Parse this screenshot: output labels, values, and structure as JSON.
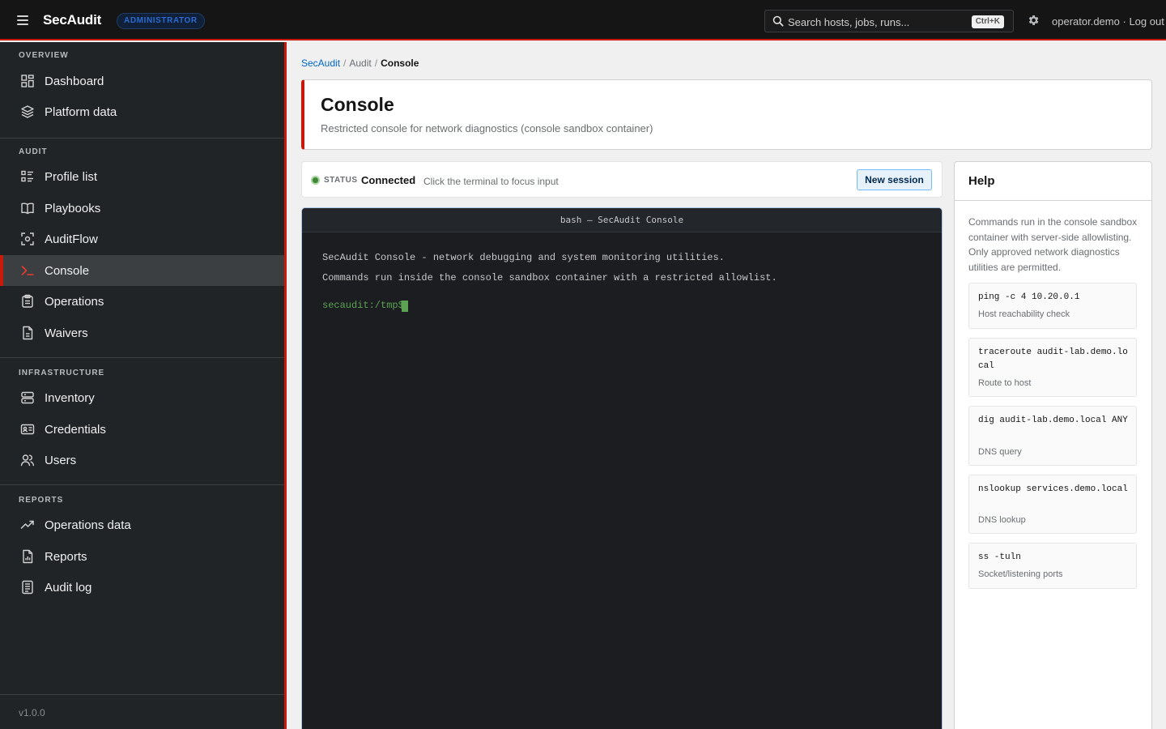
{
  "app": {
    "brand": "SecAudit",
    "role_badge": "ADMINISTRATOR",
    "search_placeholder": "Search hosts, jobs, runs...",
    "search_shortcut": "Ctrl+K",
    "user": "operator.demo",
    "separator": "·",
    "logout": "Log out"
  },
  "sidebar": {
    "groups": [
      {
        "title": "OVERVIEW",
        "items": [
          {
            "label": "Dashboard",
            "icon": "dashboard-icon"
          },
          {
            "label": "Platform data",
            "icon": "layers-icon"
          }
        ]
      },
      {
        "title": "AUDIT",
        "items": [
          {
            "label": "Profile list",
            "icon": "list-icon"
          },
          {
            "label": "Playbooks",
            "icon": "book-icon"
          },
          {
            "label": "AuditFlow",
            "icon": "scan-icon"
          },
          {
            "label": "Console",
            "icon": "terminal-icon",
            "active": true
          },
          {
            "label": "Operations",
            "icon": "clipboard-icon"
          },
          {
            "label": "Waivers",
            "icon": "document-icon"
          }
        ]
      },
      {
        "title": "INFRASTRUCTURE",
        "items": [
          {
            "label": "Inventory",
            "icon": "server-icon"
          },
          {
            "label": "Credentials",
            "icon": "id-card-icon"
          },
          {
            "label": "Users",
            "icon": "users-icon"
          }
        ]
      },
      {
        "title": "REPORTS",
        "items": [
          {
            "label": "Operations data",
            "icon": "trend-icon"
          },
          {
            "label": "Reports",
            "icon": "report-icon"
          },
          {
            "label": "Audit log",
            "icon": "log-icon"
          }
        ]
      }
    ],
    "version": "v1.0.0"
  },
  "breadcrumb": {
    "root": "SecAudit",
    "section": "Audit",
    "current": "Console",
    "sep": "/"
  },
  "page": {
    "title": "Console",
    "subtitle": "Restricted console for network diagnostics (console sandbox container)"
  },
  "status": {
    "key": "STATUS",
    "value": "Connected",
    "hint": "Click the terminal to focus input",
    "button": "New session",
    "color": "#3e8635"
  },
  "terminal": {
    "title": "bash — SecAudit Console",
    "lines": [
      "SecAudit Console - network debugging and system monitoring utilities.",
      "Commands run inside the console sandbox container with a restricted allowlist."
    ],
    "prompt": "secaudit:/tmp$"
  },
  "help": {
    "title": "Help",
    "description": "Commands run in the console sandbox container with server-side allowlisting. Only approved network diagnostics utilities are permitted.",
    "commands": [
      {
        "cmd": "ping -c 4 10.20.0.1",
        "desc": "Host reachability check"
      },
      {
        "cmd": "traceroute audit-lab.demo.local",
        "desc": "Route to host"
      },
      {
        "cmd": "dig audit-lab.demo.local ANY",
        "desc": "DNS query"
      },
      {
        "cmd": "nslookup services.demo.local",
        "desc": "DNS lookup"
      },
      {
        "cmd": "ss -tuln",
        "desc": "Socket/listening ports"
      }
    ]
  },
  "colors": {
    "accent": "#c9190b",
    "link": "#0066cc",
    "prompt": "#5ba352"
  }
}
